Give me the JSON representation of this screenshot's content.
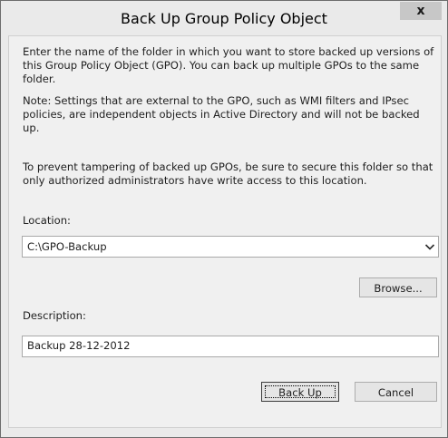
{
  "window": {
    "title": "Back Up Group Policy Object",
    "close_glyph": "x"
  },
  "body": {
    "intro": "Enter the name of the folder in which you want to store backed up versions of this Group Policy Object (GPO). You can back up multiple GPOs to the same folder.",
    "note": "Note: Settings that are external to the GPO, such as WMI filters and IPsec policies, are independent objects in Active Directory and will not be backed up.",
    "warning": "To prevent tampering of backed up GPOs, be sure to secure this folder so that only authorized administrators have write access to this location."
  },
  "location": {
    "label": "Location:",
    "value": "C:\\GPO-Backup",
    "dropdown_icon": "chevron-down-icon"
  },
  "browse_label": "Browse...",
  "description": {
    "label": "Description:",
    "value": "Backup 28-12-2012"
  },
  "buttons": {
    "backup_label": "Back Up",
    "cancel_label": "Cancel"
  },
  "colors": {
    "dialog_background": "#f0f0f0",
    "frame": "#eaeaea",
    "close_button": "#c7c7c7"
  }
}
